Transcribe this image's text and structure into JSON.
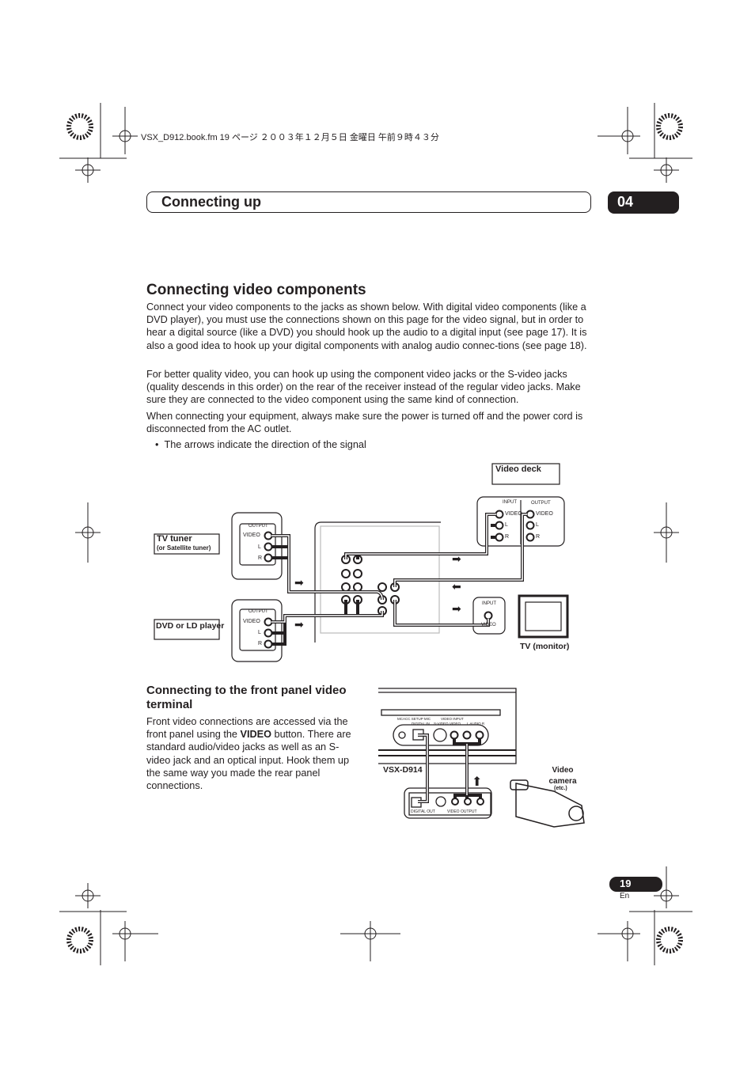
{
  "print_header": "VSX_D912.book.fm  19 ページ  ２００３年１２月５日  金曜日  午前９時４３分",
  "chapter": {
    "title": "Connecting up",
    "number": "04"
  },
  "section": {
    "title": "Connecting video components",
    "paragraphs": [
      "Connect your video components to the jacks as shown below. With digital video components (like a DVD player), you must use the connections shown on this page for the video signal, but in order to hear a digital source (like a DVD) you should hook up the audio to a digital input (see page 17). It is also a good idea to hook up your digital components with analog audio connec-tions (see page 18).",
      "For better quality video, you can hook up using the component video jacks or the S-video jacks (quality descends in this order) on the rear of the receiver instead of the regular video jacks. Make sure they are connected to the video component using the same kind of connection.",
      "When connecting your equipment, always make sure the power is turned off and the power cord is disconnected from the AC outlet."
    ],
    "bullet": "The arrows indicate the direction of the signal"
  },
  "diagram_rear": {
    "tv_tuner": "TV tuner",
    "tv_tuner_sub": "(or Satellite tuner)",
    "dvd": "DVD or LD player",
    "video_deck": "Video deck",
    "tv_monitor": "TV (monitor)",
    "output": "OUTPUT",
    "input": "INPUT",
    "video": "VIDEO",
    "l": "L",
    "r": "R"
  },
  "subsection": {
    "title": "Connecting to the front panel video terminal",
    "text_before": "Front video connections are accessed via the front panel using the ",
    "text_bold": "VIDEO",
    "text_after": " button. There are standard audio/video jacks as well as an S-video jack and an optical input. Hook them up the same way you made the rear panel connections."
  },
  "diagram_front": {
    "model": "VSX-D914",
    "camera": "Video camera",
    "camera_sub": "(etc.)",
    "digital_out": "DIGITAL OUT",
    "video_output": "VIDEO OUTPUT",
    "video_input": "VIDEO INPUT",
    "mcacc": "MCACC SETUP MIC",
    "digital_in": "DIGITAL IN",
    "s_video": "S-VIDEO",
    "video": "VIDEO",
    "audio": "L  AUDIO  R"
  },
  "footer": {
    "page": "19",
    "lang": "En"
  }
}
